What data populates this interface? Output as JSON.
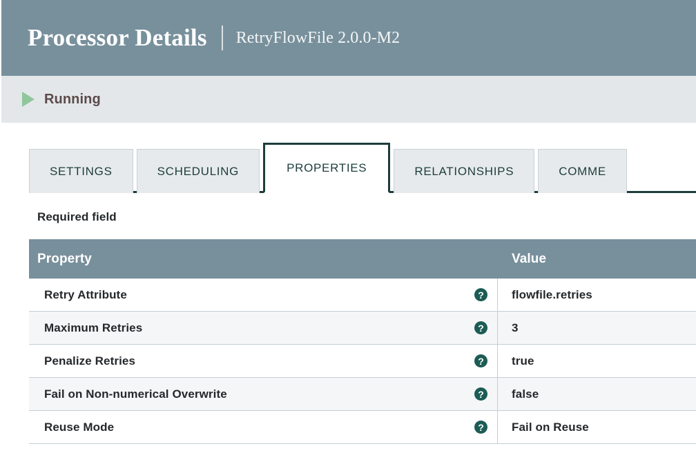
{
  "header": {
    "title": "Processor Details",
    "separator": "|",
    "subtitle": "RetryFlowFile 2.0.0-M2"
  },
  "status": {
    "label": "Running",
    "icon": "play-triangle-icon",
    "icon_color": "#8ec79b",
    "text_color": "#5d4a4a",
    "background": "#e3e7ea"
  },
  "tabs": {
    "items": [
      {
        "label": "SETTINGS",
        "active": false
      },
      {
        "label": "SCHEDULING",
        "active": false
      },
      {
        "label": "PROPERTIES",
        "active": true
      },
      {
        "label": "RELATIONSHIPS",
        "active": false
      },
      {
        "label": "COMME",
        "active": false
      }
    ],
    "accent_color": "#1e3c3c"
  },
  "content": {
    "required_field_label": "Required field",
    "table": {
      "columns": [
        "Property",
        "Value"
      ],
      "header_background": "#78909c",
      "help_icon": "?",
      "help_icon_color": "#1c5c55",
      "rows": [
        {
          "property": "Retry Attribute",
          "value": "flowfile.retries"
        },
        {
          "property": "Maximum Retries",
          "value": "3"
        },
        {
          "property": "Penalize Retries",
          "value": "true"
        },
        {
          "property": "Fail on Non-numerical Overwrite",
          "value": "false"
        },
        {
          "property": "Reuse Mode",
          "value": "Fail on Reuse"
        }
      ]
    }
  }
}
